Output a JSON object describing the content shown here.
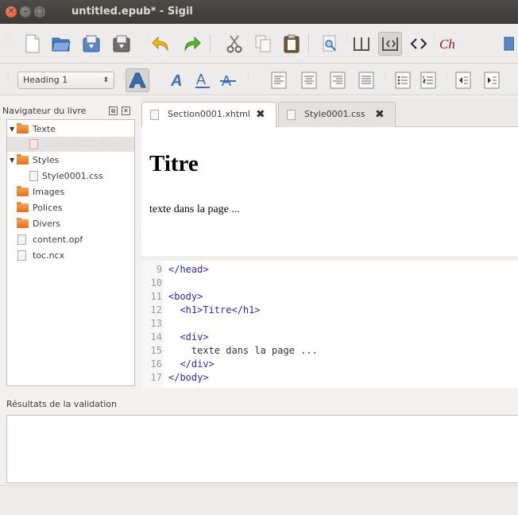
{
  "window": {
    "title": "untitled.epub* - Sigil"
  },
  "toolbar": {
    "row1_icons": [
      "new-file-icon",
      "open-icon",
      "save-icon",
      "save-as-icon",
      "undo-icon",
      "redo-icon",
      "cut-icon",
      "copy-icon",
      "paste-icon",
      "find-replace-icon",
      "book-view-icon",
      "split-view-icon",
      "code-view-icon",
      "spellcheck-icon"
    ],
    "row2_icons": [
      "bold-icon",
      "italic-icon",
      "underline-icon",
      "strikethrough-icon",
      "align-left-icon",
      "align-center-icon",
      "align-right-icon",
      "justify-icon",
      "bullet-list-icon",
      "numbered-list-icon",
      "decrease-indent-icon"
    ],
    "heading_select": "Heading 1"
  },
  "navigator": {
    "title": "Navigateur du livre",
    "items": [
      {
        "label": "Texte",
        "type": "folder",
        "expanded": true
      },
      {
        "label": "Section0001.xhtml",
        "type": "xhtml",
        "selected": true
      },
      {
        "label": "Styles",
        "type": "folder",
        "expanded": true
      },
      {
        "label": "Style0001.css",
        "type": "css"
      },
      {
        "label": "Images",
        "type": "folder"
      },
      {
        "label": "Polices",
        "type": "folder"
      },
      {
        "label": "Divers",
        "type": "folder"
      },
      {
        "label": "content.opf",
        "type": "file"
      },
      {
        "label": "toc.ncx",
        "type": "file"
      }
    ]
  },
  "tabs": [
    {
      "label": "Section0001.xhtml",
      "active": true
    },
    {
      "label": "Style0001.css",
      "active": false
    }
  ],
  "preview": {
    "heading": "Titre",
    "paragraph": "texte dans la page ..."
  },
  "code": {
    "lines": [
      {
        "num": "9",
        "text": "</head>"
      },
      {
        "num": "10",
        "text": ""
      },
      {
        "num": "11",
        "text": "<body>"
      },
      {
        "num": "12",
        "text": "  <h1>Titre</h1>"
      },
      {
        "num": "13",
        "text": ""
      },
      {
        "num": "14",
        "text": "  <div>"
      },
      {
        "num": "15",
        "text": "    texte dans la page ..."
      },
      {
        "num": "16",
        "text": "  </div>"
      },
      {
        "num": "17",
        "text": "</body>"
      }
    ]
  },
  "validation": {
    "title": "Résultats de la validation"
  },
  "colors": {
    "accent": "#e24c21",
    "folder": "#e0701a",
    "code_tag": "#2b2b99"
  }
}
